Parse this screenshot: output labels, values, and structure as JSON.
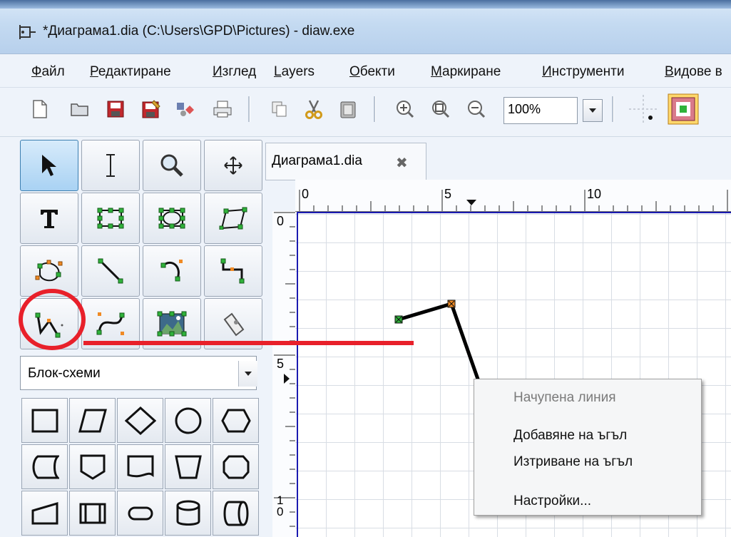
{
  "window": {
    "title": "*Диаграма1.dia (C:\\Users\\GPD\\Pictures) - diaw.exe"
  },
  "menubar": {
    "items": [
      "Файл",
      "Редактиране",
      "Изглед",
      "Layers",
      "Обекти",
      "Маркиране",
      "Инструменти",
      "Видове в"
    ]
  },
  "toolbar": {
    "zoom_value": "100%"
  },
  "toolbox": {
    "sheet_selected": "Блок-схеми"
  },
  "tabs": [
    {
      "label": "Диаграма1.dia"
    }
  ],
  "ruler": {
    "h_labels": [
      "0",
      "5",
      "10"
    ],
    "v_labels": [
      "0",
      "5",
      "1\n0"
    ]
  },
  "context_menu": {
    "title": "Начупена линия",
    "items": [
      "Добавяне на ъгъл",
      "Изтриване на ъгъл",
      "Настройки..."
    ]
  },
  "colors": {
    "annotation": "#e8202a",
    "selection": "#1a1ab0"
  }
}
